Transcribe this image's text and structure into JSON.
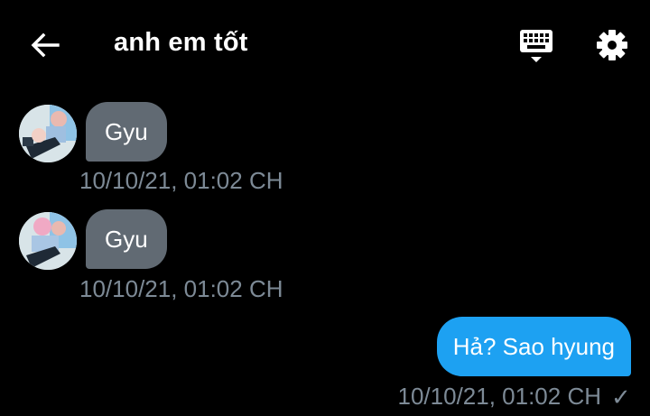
{
  "header": {
    "title": "anh em tốt",
    "back_icon": "arrow-left-icon",
    "keyboard_icon": "keyboard-icon",
    "settings_icon": "gear-icon"
  },
  "messages": [
    {
      "direction": "incoming",
      "text": "Gyu",
      "timestamp": "10/10/21, 01:02 CH"
    },
    {
      "direction": "incoming",
      "text": "Gyu",
      "timestamp": "10/10/21, 01:02 CH"
    },
    {
      "direction": "outgoing",
      "text": "Hả? Sao hyung",
      "timestamp": "10/10/21, 01:02 CH",
      "status_icon": "check-icon",
      "status_glyph": "✓"
    }
  ],
  "colors": {
    "background": "#000000",
    "incoming_bubble": "#616a73",
    "outgoing_bubble": "#1da1f2",
    "timestamp": "#7d8a96"
  }
}
